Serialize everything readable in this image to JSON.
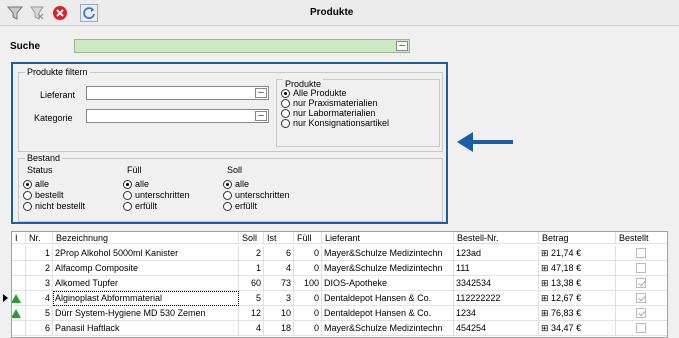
{
  "window": {
    "title": "Produkte"
  },
  "toolbar": {
    "icons": [
      "filter-icon",
      "filter-clear-icon",
      "close-icon",
      "refresh-icon"
    ],
    "colors": {
      "close": "#e02020",
      "refresh": "#2a7cd8"
    }
  },
  "search": {
    "label": "Suche",
    "value": "",
    "button": "..."
  },
  "filter_panel": {
    "title": "Produkte filtern",
    "lieferant": {
      "label": "Lieferant",
      "value": "",
      "button": "..."
    },
    "kategorie": {
      "label": "Kategorie",
      "value": "",
      "button": "..."
    },
    "produkte": {
      "title": "Produkte",
      "options": [
        "Alle Produkte",
        "nur Praxismaterialien",
        "nur Labormaterialien",
        "nur Konsignationsartikel"
      ],
      "selected": 0
    },
    "bestand": {
      "title": "Bestand",
      "status": {
        "title": "Status",
        "options": [
          "alle",
          "bestellt",
          "nicht bestellt"
        ],
        "selected": 0
      },
      "fuell": {
        "title": "Füll",
        "options": [
          "alle",
          "unterschritten",
          "erfüllt"
        ],
        "selected": 0
      },
      "soll": {
        "title": "Soll",
        "options": [
          "alle",
          "unterschritten",
          "erfüllt"
        ],
        "selected": 0
      }
    },
    "border_color": "#1a5ea8"
  },
  "annotation_arrow": {
    "color": "#1a5ea8",
    "icon": "arrow-left-icon"
  },
  "table": {
    "columns": [
      "I",
      "Nr.",
      "Bezeichnung",
      "Soll",
      "Ist",
      "Füll",
      "Lieferant",
      "Bestell-Nr.",
      "Betrag",
      "Bestellt"
    ],
    "rows": [
      {
        "warn": false,
        "current": false,
        "nr": "1",
        "bezeichnung": "2Prop Alkohol 5000ml Kanister",
        "soll": "2",
        "ist": "6",
        "fuell": "0",
        "lieferant": "Mayer&Schulze Medizintechn",
        "bestellnr": "123ad",
        "betrag": "⊞ 21,74 €",
        "bestellt": false
      },
      {
        "warn": false,
        "current": false,
        "nr": "2",
        "bezeichnung": "Alfacomp Composite",
        "soll": "1",
        "ist": "4",
        "fuell": "0",
        "lieferant": "Mayer&Schulze Medizintechn",
        "bestellnr": "111",
        "betrag": "⊞ 47,18 €",
        "bestellt": false
      },
      {
        "warn": false,
        "current": false,
        "nr": "3",
        "bezeichnung": "Alkomed Tupfer",
        "soll": "60",
        "ist": "73",
        "fuell": "100",
        "lieferant": "DIOS-Apotheke",
        "bestellnr": "3342534",
        "betrag": "⊞ 13,38 €",
        "bestellt": true
      },
      {
        "warn": true,
        "current": true,
        "nr": "4",
        "bezeichnung": "Alginoplast Abformmaterial",
        "soll": "5",
        "ist": "3",
        "fuell": "0",
        "lieferant": "Dentaldepot Hansen & Co.",
        "bestellnr": "112222222",
        "betrag": "⊞ 12,67 €",
        "bestellt": true
      },
      {
        "warn": true,
        "current": false,
        "nr": "5",
        "bezeichnung": "Dürr System-Hygiene MD 530 Zemen",
        "soll": "12",
        "ist": "10",
        "fuell": "0",
        "lieferant": "Dentaldepot Hansen & Co.",
        "bestellnr": "1234",
        "betrag": "⊞ 76,83 €",
        "bestellt": true
      },
      {
        "warn": false,
        "current": false,
        "nr": "6",
        "bezeichnung": "Panasil Haftlack",
        "soll": "4",
        "ist": "18",
        "fuell": "0",
        "lieferant": "Mayer&Schulze Medizintechn",
        "bestellnr": "454254",
        "betrag": "⊞ 34,47 €",
        "bestellt": false
      }
    ]
  }
}
